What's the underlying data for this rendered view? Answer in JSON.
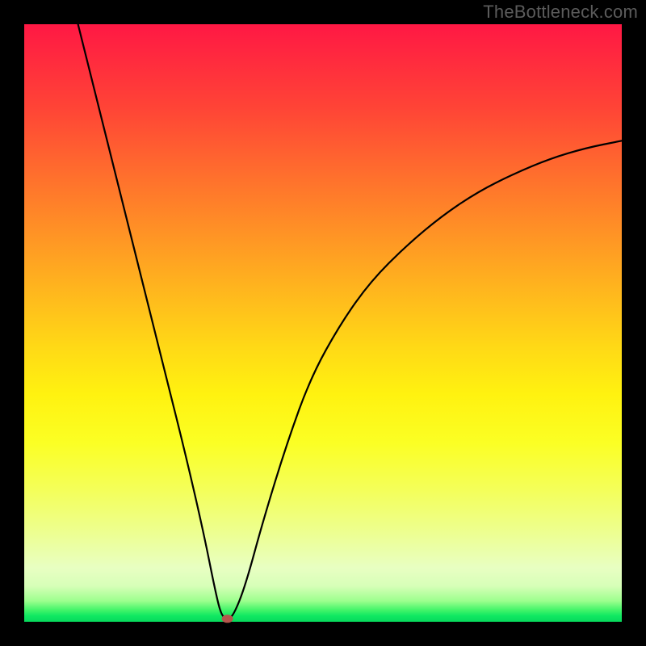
{
  "watermark": "TheBottleneck.com",
  "chart_data": {
    "type": "line",
    "title": "",
    "xlabel": "",
    "ylabel": "",
    "xlim": [
      0,
      100
    ],
    "ylim": [
      0,
      100
    ],
    "grid": false,
    "legend": false,
    "annotations": [],
    "series": [
      {
        "name": "bottleneck-curve",
        "x": [
          9,
          12,
          15,
          18,
          21,
          24,
          27,
          30,
          32,
          33,
          34,
          35,
          37,
          40,
          44,
          48,
          53,
          58,
          64,
          70,
          76,
          82,
          88,
          94,
          100
        ],
        "y": [
          100,
          88,
          76,
          64,
          52,
          40,
          28,
          15,
          5,
          1,
          0.5,
          1,
          6,
          17,
          30,
          41,
          50,
          57,
          63,
          68,
          72,
          75,
          77.5,
          79.3,
          80.5
        ]
      }
    ],
    "minimum_point": {
      "x": 34,
      "y": 0.5
    },
    "background_gradient": {
      "direction": "vertical",
      "stops": [
        {
          "pos": 0.0,
          "color": "#ff1844"
        },
        {
          "pos": 0.5,
          "color": "#ffd916"
        },
        {
          "pos": 0.95,
          "color": "#e8ffc2"
        },
        {
          "pos": 1.0,
          "color": "#07d95c"
        }
      ]
    }
  }
}
